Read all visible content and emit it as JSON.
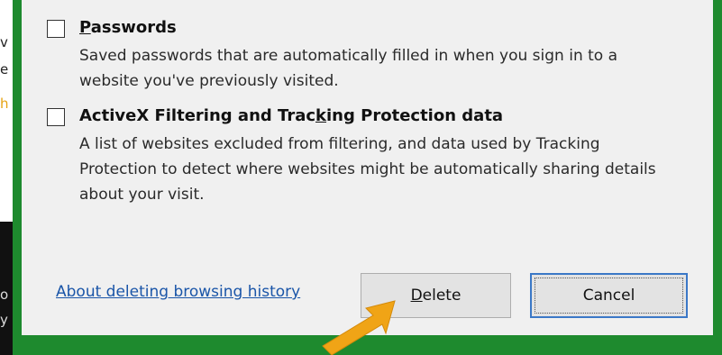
{
  "background_window": {
    "fragments": [
      "v",
      "e",
      "h",
      "o",
      "y"
    ]
  },
  "dialog": {
    "options": [
      {
        "title_prefix": "P",
        "title_rest": "asswords",
        "checked": false,
        "description": "Saved passwords that are automatically filled in when you sign in to a website you've previously visited."
      },
      {
        "title_prefix": "ActiveX Filtering and Trac",
        "title_accel": "k",
        "title_rest": "ing Protection data",
        "checked": false,
        "description": "A list of websites excluded from filtering, and data used by Tracking Protection to detect where websites might be automatically sharing details about your visit."
      }
    ],
    "help_link": "About deleting browsing history",
    "delete_button": {
      "accel": "D",
      "rest": "elete"
    },
    "cancel_button": "Cancel"
  },
  "colors": {
    "window_border": "#1e8a2e",
    "dialog_bg": "#f0f0f0",
    "link": "#1a55a8",
    "focus_border": "#3b78c7",
    "arrow": "#f0a416"
  },
  "icons": [
    "checkbox",
    "pointer-arrow"
  ]
}
